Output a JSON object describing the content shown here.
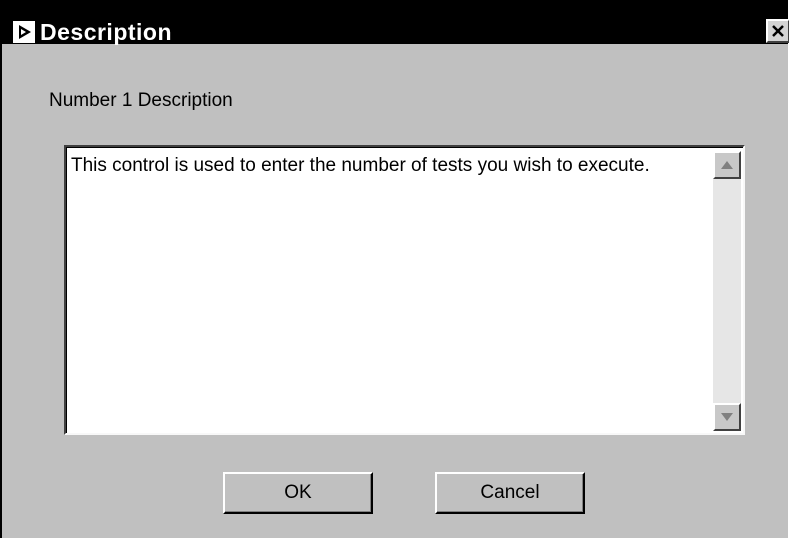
{
  "window": {
    "title": "Description",
    "app_icon": "labview-run-icon",
    "close_icon": "close-icon"
  },
  "description": {
    "label": "Number 1 Description",
    "text": "This control is used to enter the number of tests you wish to execute."
  },
  "buttons": {
    "ok_label": "OK",
    "cancel_label": "Cancel"
  },
  "colors": {
    "titlebar": "#000000",
    "dialog_bg": "#c0c0c0",
    "text_bg": "#ffffff"
  }
}
